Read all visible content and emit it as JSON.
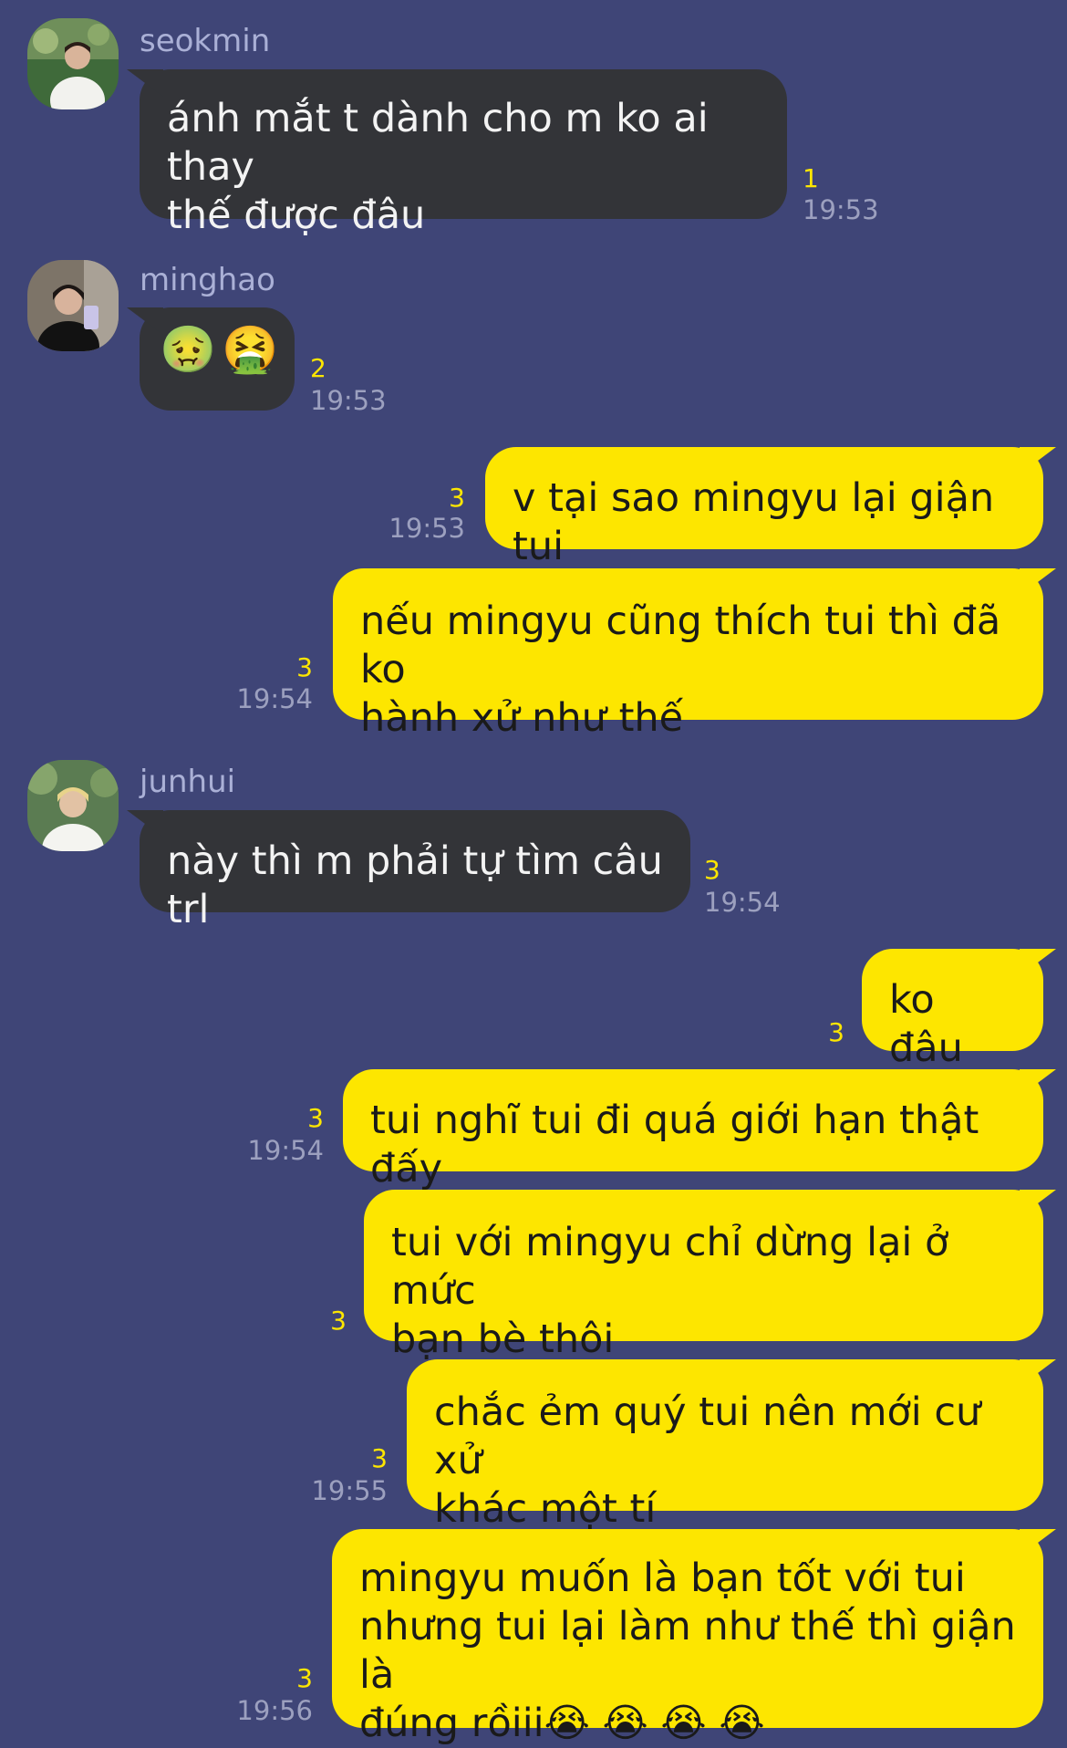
{
  "messages": [
    {
      "sender": "seokmin",
      "line1": "ánh mắt t dành cho m ko ai thay",
      "line2": "thế được đâu",
      "count": "1",
      "time": "19:53"
    },
    {
      "sender": "minghao",
      "emoji": "🤢🤮",
      "count": "2",
      "time": "19:53"
    },
    {
      "text": "v tại sao mingyu lại giận tui",
      "count": "3",
      "time": "19:53"
    },
    {
      "line1": "nếu mingyu cũng thích tui thì đã ko",
      "line2": "hành xử như thế",
      "count": "3",
      "time": "19:54"
    },
    {
      "sender": "junhui",
      "text": "này thì m phải tự tìm câu trl",
      "count": "3",
      "time": "19:54"
    },
    {
      "text": "ko đâu",
      "count": "3"
    },
    {
      "text": "tui nghĩ tui đi quá giới hạn thật đấy",
      "count": "3",
      "time": "19:54"
    },
    {
      "line1": "tui với mingyu chỉ dừng lại ở mức",
      "line2": "bạn bè thôi",
      "count": "3"
    },
    {
      "line1": "chắc ẻm quý tui nên mới cư xử",
      "line2": "khác một tí",
      "count": "3",
      "time": "19:55"
    },
    {
      "line1": "mingyu muốn là bạn tốt với tui",
      "line2": "nhưng tui lại làm như thế thì giận là",
      "line3": "đúng rồiii😭 😭 😭 😭",
      "count": "3",
      "time": "19:56"
    }
  ],
  "avatars": [
    {
      "icon": "seokmin-avatar-photo",
      "bg": "#3f6a3a"
    },
    {
      "icon": "minghao-avatar-photo",
      "bg": "#7d7468"
    },
    {
      "icon": "junhui-avatar-photo",
      "bg": "#5b7c52"
    }
  ],
  "colors": {
    "background": "#3f4577",
    "received_bubble": "#333438",
    "sent_bubble": "#fde600",
    "unread_count": "#fde600",
    "timestamp": "#9ca0bf",
    "sender_name": "#aab0d6"
  }
}
